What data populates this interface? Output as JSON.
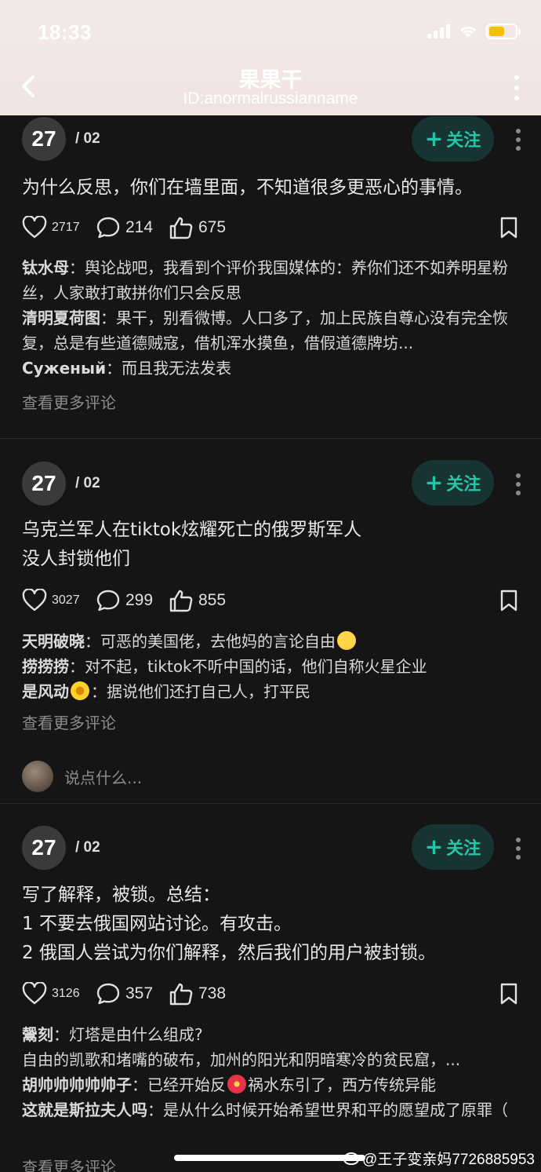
{
  "status_bar": {
    "time": "18:33"
  },
  "header": {
    "title": "果果干",
    "subtitle": "ID:anormalrussianname"
  },
  "posts": [
    {
      "day": "27",
      "month": "/ 02",
      "follow_label": "关注",
      "text": "为什么反思，你们在墙里面，不知道很多更恶心的事情。",
      "likes": "2717",
      "comments_count": "214",
      "thumbs": "675",
      "comments": [
        {
          "author": "钛水母",
          "sep": "：",
          "text": "舆论战吧，我看到个评价我国媒体的：养你们还不如养明星粉丝，人家敢打敢拼你们只会反思"
        },
        {
          "author": "清明夏荷图",
          "sep": "：",
          "text": "果干，别看微博。人口多了，加上民族自尊心没有完全恢复，总是有些道德贼寇，借机浑水摸鱼，借假道德牌坊..."
        },
        {
          "author": "Суженый",
          "sep": "：",
          "text": "而且我无法发表"
        }
      ],
      "more_comments": "查看更多评论"
    },
    {
      "day": "27",
      "month": "/ 02",
      "follow_label": "关注",
      "text_lines": [
        "乌克兰军人在tiktok炫耀死亡的俄罗斯军人",
        "没人封锁他们"
      ],
      "likes": "3027",
      "comments_count": "299",
      "thumbs": "855",
      "comments": [
        {
          "author": "天明破晓",
          "sep": "：",
          "text": "可恶的美国佬，去他妈的言论自由"
        },
        {
          "author": "捞捞捞",
          "sep": "：",
          "text": "对不起，tiktok不听中国的话，他们自称火星企业"
        },
        {
          "author": "是风动",
          "sep": "：",
          "text": "据说他们还打自己人，打平民"
        }
      ],
      "more_comments": "查看更多评论",
      "reply_placeholder": "说点什么..."
    },
    {
      "day": "27",
      "month": "/ 02",
      "follow_label": "关注",
      "text_lines": [
        "写了解释，被锁。总结：",
        "1 不要去俄国网站讨论。有攻击。",
        "2 俄国人尝试为你们解释，然后我们的用户被封锁。"
      ],
      "likes": "3126",
      "comments_count": "357",
      "thumbs": "738",
      "comments": [
        {
          "author": "鬶刻",
          "sep": "：",
          "text": "灯塔是由什么组成?"
        },
        {
          "author": "",
          "sep": "",
          "text": "自由的凯歌和堵嘴的破布，加州的阳光和阴暗寒冷的贫民窟，..."
        },
        {
          "author": "胡帅帅帅帅帅子",
          "sep": "：",
          "text_a": "已经开始反",
          "text_b": "祸水东引了，西方传统异能"
        },
        {
          "author": "这就是斯拉夫人吗",
          "sep": "：",
          "text": "是从什么时候开始希望世界和平的愿望成了原罪（"
        }
      ],
      "more_comments": "查看更多评论"
    }
  ],
  "watermark": "@王子变亲妈7726885953"
}
